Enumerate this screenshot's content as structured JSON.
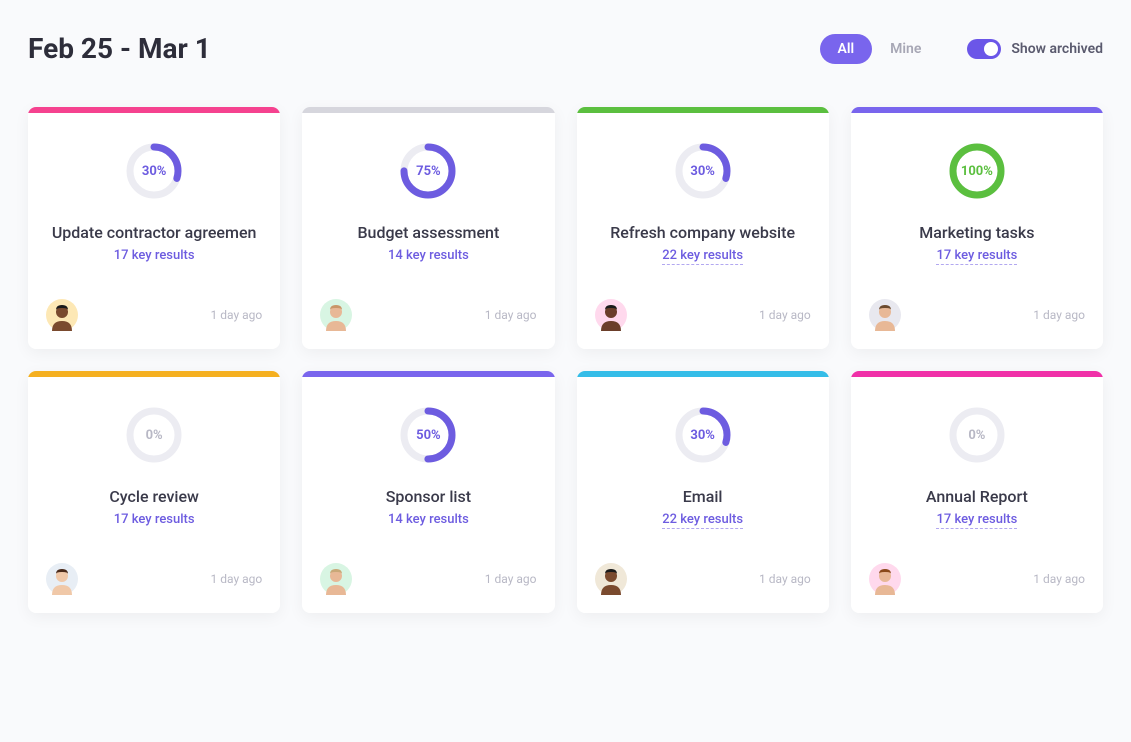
{
  "header": {
    "date_range": "Feb 25 - Mar 1",
    "filter_all": "All",
    "filter_mine": "Mine",
    "toggle_label": "Show archived"
  },
  "colors": {
    "purple": "#7965ed",
    "ring_purple": "#6d5ce0",
    "ring_green": "#55cf0b"
  },
  "cards": [
    {
      "accent": "#f5428f",
      "progress": 30,
      "ring_color": "#6d5ce0",
      "text_color": "#6d5ce0",
      "title": "Update contractor agreemen",
      "subtitle": "17 key results",
      "linked": false,
      "timestamp": "1 day ago",
      "avatar_bg": "#fde8b5",
      "avatar_skin": "#7a4a2e",
      "avatar_hair": "#1a1a1a"
    },
    {
      "accent": "#d6d6dd",
      "progress": 75,
      "ring_color": "#6d5ce0",
      "text_color": "#6d5ce0",
      "title": "Budget assessment",
      "subtitle": "14 key results",
      "linked": false,
      "timestamp": "1 day ago",
      "avatar_bg": "#d8f5e3",
      "avatar_skin": "#e8b896",
      "avatar_hair": "#c99668"
    },
    {
      "accent": "#5bbf3f",
      "progress": 30,
      "ring_color": "#6d5ce0",
      "text_color": "#6d5ce0",
      "title": "Refresh company website",
      "subtitle": "22 key results",
      "linked": true,
      "timestamp": "1 day ago",
      "avatar_bg": "#ffd9ed",
      "avatar_skin": "#6b3e2a",
      "avatar_hair": "#1a1a1a"
    },
    {
      "accent": "#7965ed",
      "progress": 100,
      "ring_color": "#5bbf3f",
      "text_color": "#5bbf3f",
      "title": "Marketing tasks",
      "subtitle": "17 key results",
      "linked": true,
      "timestamp": "1 day ago",
      "avatar_bg": "#e8e8ef",
      "avatar_skin": "#e8b896",
      "avatar_hair": "#6b4a2e"
    },
    {
      "accent": "#f5b020",
      "progress": 0,
      "ring_color": "#6d5ce0",
      "text_color": "#b8b8c5",
      "title": "Cycle review",
      "subtitle": "17 key results",
      "linked": false,
      "timestamp": "1 day ago",
      "avatar_bg": "#e8eef5",
      "avatar_skin": "#f0c8a8",
      "avatar_hair": "#4a2a1a"
    },
    {
      "accent": "#7965ed",
      "progress": 50,
      "ring_color": "#6d5ce0",
      "text_color": "#6d5ce0",
      "title": "Sponsor list",
      "subtitle": "14 key results",
      "linked": false,
      "timestamp": "1 day ago",
      "avatar_bg": "#d8f5e3",
      "avatar_skin": "#e8b896",
      "avatar_hair": "#c9a878"
    },
    {
      "accent": "#35bde8",
      "progress": 30,
      "ring_color": "#6d5ce0",
      "text_color": "#6d5ce0",
      "title": "Email",
      "subtitle": "22 key results",
      "linked": true,
      "timestamp": "1 day ago",
      "avatar_bg": "#f0e8d8",
      "avatar_skin": "#7a4a2e",
      "avatar_hair": "#1a1a1a"
    },
    {
      "accent": "#f030a8",
      "progress": 0,
      "ring_color": "#6d5ce0",
      "text_color": "#b8b8c5",
      "title": "Annual Report",
      "subtitle": "17 key results",
      "linked": true,
      "timestamp": "1 day ago",
      "avatar_bg": "#ffd9ed",
      "avatar_skin": "#e8b896",
      "avatar_hair": "#8a4a1a"
    }
  ]
}
